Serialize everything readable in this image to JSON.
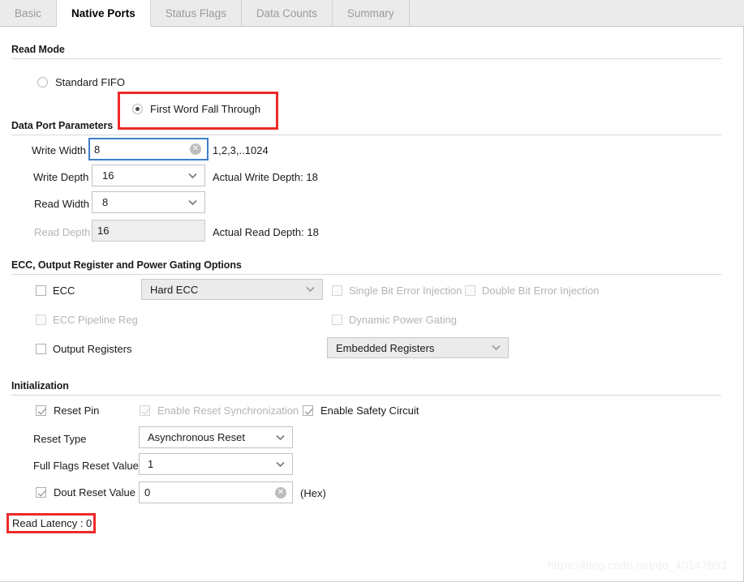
{
  "tabs": [
    {
      "label": "Basic",
      "active": false
    },
    {
      "label": "Native Ports",
      "active": true
    },
    {
      "label": "Status Flags",
      "active": false
    },
    {
      "label": "Data Counts",
      "active": false
    },
    {
      "label": "Summary",
      "active": false
    }
  ],
  "sections": {
    "read_mode": {
      "title": "Read Mode",
      "options": [
        {
          "label": "Standard FIFO",
          "selected": false
        },
        {
          "label": "First Word Fall Through",
          "selected": true
        }
      ]
    },
    "data_port": {
      "title": "Data Port Parameters",
      "write_width": {
        "label": "Write Width",
        "value": "8",
        "hint": "1,2,3,..1024"
      },
      "write_depth": {
        "label": "Write Depth",
        "value": "16",
        "note": "Actual Write Depth: 18"
      },
      "read_width": {
        "label": "Read Width",
        "value": "8",
        "note": ""
      },
      "read_depth": {
        "label": "Read Depth",
        "value": "16",
        "note": "Actual Read Depth: 18"
      }
    },
    "ecc": {
      "title": "ECC, Output Register and Power Gating Options",
      "ecc_checkbox": "ECC",
      "ecc_mode": "Hard ECC",
      "single_bit": "Single Bit Error Injection",
      "double_bit": "Double Bit Error Injection",
      "pipeline_reg": "ECC Pipeline Reg",
      "dynamic_power_gating": "Dynamic Power Gating",
      "output_registers": "Output Registers",
      "output_registers_mode": "Embedded Registers"
    },
    "init": {
      "title": "Initialization",
      "reset_pin": "Reset Pin",
      "enable_reset_sync": "Enable Reset Synchronization",
      "enable_safety_circuit": "Enable Safety Circuit",
      "reset_type": {
        "label": "Reset Type",
        "value": "Asynchronous Reset"
      },
      "full_flags_reset": {
        "label": "Full Flags Reset Value",
        "value": "1"
      },
      "dout_reset": {
        "label": "Dout Reset Value",
        "value": "0",
        "suffix": "(Hex)"
      }
    }
  },
  "read_latency": "Read Latency : 0",
  "watermark": "https://blog.csdn.net/qq_40147893",
  "icons": {
    "clear": "✕",
    "chevron_down": "chevron-down-icon"
  },
  "colors": {
    "annotation": "#ee2a2a",
    "focus": "#3f7ec9",
    "tab_active_bg": "#ffffff",
    "tab_bg": "#ebebeb"
  }
}
